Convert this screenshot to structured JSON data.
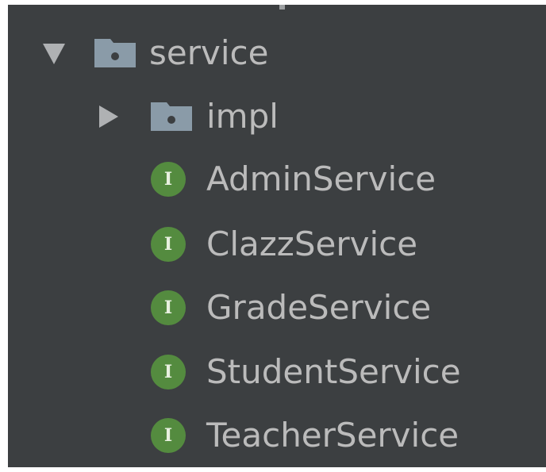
{
  "project_tree": {
    "service_folder": {
      "label": "service",
      "expanded": true,
      "icon": "package-folder-icon"
    },
    "impl_folder": {
      "label": "impl",
      "expanded": false,
      "icon": "package-folder-icon"
    },
    "interfaces": [
      {
        "label": "AdminService",
        "badge": "I",
        "icon": "interface-icon"
      },
      {
        "label": "ClazzService",
        "badge": "I",
        "icon": "interface-icon"
      },
      {
        "label": "GradeService",
        "badge": "I",
        "icon": "interface-icon"
      },
      {
        "label": "StudentService",
        "badge": "I",
        "icon": "interface-icon"
      },
      {
        "label": "TeacherService",
        "badge": "I",
        "icon": "interface-icon"
      }
    ]
  },
  "colors": {
    "panel_background": "#3c3f41",
    "text": "#bbbbbb",
    "arrow": "#afb1b3",
    "folder": "#8a9ba8",
    "interface_badge": "#548b3f"
  }
}
